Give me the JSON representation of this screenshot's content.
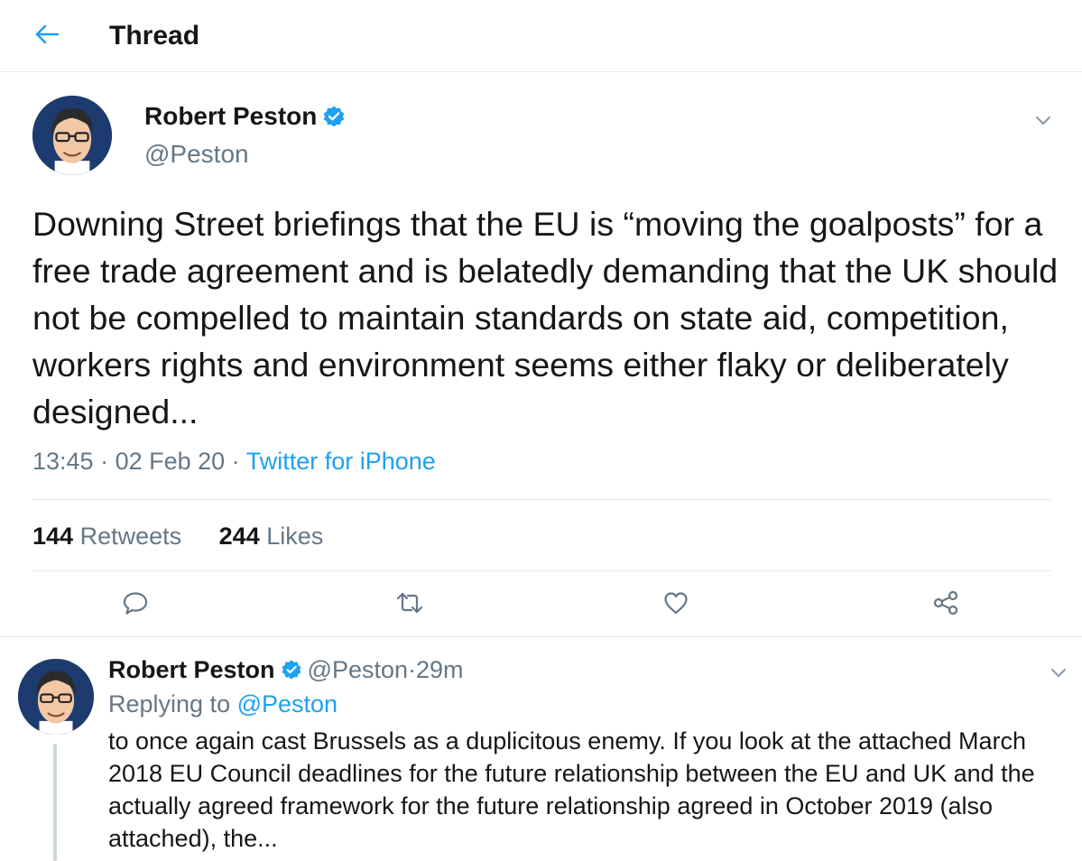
{
  "header": {
    "title": "Thread",
    "back_icon": "arrow-left-icon",
    "accent_color": "#1da1f2"
  },
  "main_tweet": {
    "author_name": "Robert Peston",
    "author_handle": "@Peston",
    "verified": true,
    "text": "Downing Street briefings that the EU is “moving the goalposts” for a free trade agreement and is belatedly demanding that the UK should not be compelled to maintain standards on state aid, competition, workers rights and environment seems either flaky or deliberately designed...",
    "time": "13:45",
    "date": "02 Feb 20",
    "source": "Twitter for iPhone",
    "retweets_count": "144",
    "retweets_label": "Retweets",
    "likes_count": "244",
    "likes_label": "Likes",
    "actions": [
      "reply-icon",
      "retweet-icon",
      "like-icon",
      "share-icon"
    ]
  },
  "reply_tweet": {
    "author_name": "Robert Peston",
    "author_handle": "@Peston",
    "time_ago": "29m",
    "verified": true,
    "replying_to_label": "Replying to",
    "replying_to_handle": "@Peston",
    "text": "to once again cast Brussels as a duplicitous enemy. If you look at the attached March 2018 EU Council deadlines for the future relationship between the EU and UK and the actually agreed framework for the future relationship agreed in October 2019 (also attached), the..."
  },
  "separators": {
    "dot": " · "
  },
  "colors": {
    "text_primary": "#14171a",
    "text_secondary": "#657786",
    "link": "#1da1f2",
    "border": "#e1e8ed"
  }
}
